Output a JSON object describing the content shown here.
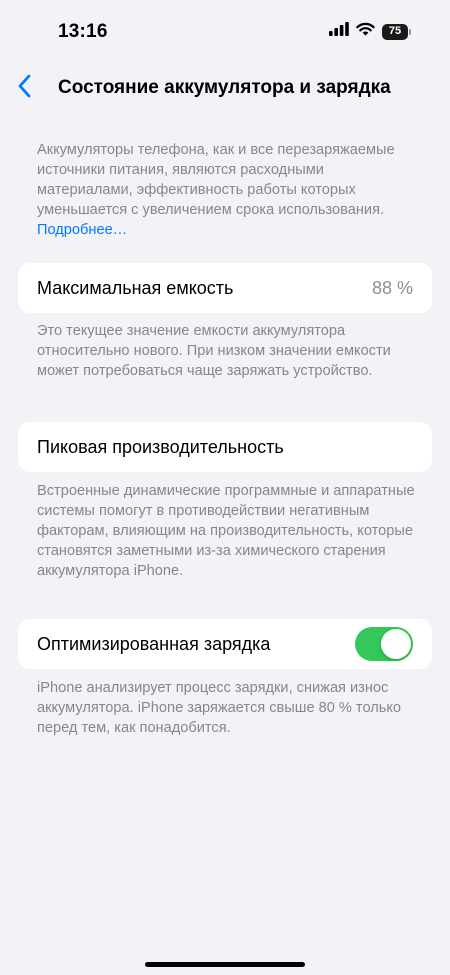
{
  "status_bar": {
    "time": "13:16",
    "battery_level": "75",
    "icons": [
      "signal-icon",
      "wifi-icon",
      "battery-icon"
    ]
  },
  "nav": {
    "back_icon": "chevron-left-icon",
    "title": "Состояние аккумулятора и зарядка"
  },
  "intro": {
    "text": "Аккумуляторы телефона, как и все перезаряжаемые источники питания, являются расходными материалами, эффективность работы которых уменьшается с увеличением срока использования. ",
    "link": "Подробнее…"
  },
  "max_capacity": {
    "label": "Максимальная емкость",
    "value": "88 %",
    "description": "Это текущее значение емкости аккумулятора относительно нового. При низком значении емкости может потребоваться чаще заряжать устройство."
  },
  "peak_performance": {
    "label": "Пиковая производительность",
    "description": "Встроенные динамические программные и аппаратные системы помогут в противодействии негативным факторам, влияющим на производительность, которые становятся заметными из-за химического старения аккумулятора iPhone."
  },
  "optimized_charging": {
    "label": "Оптимизированная зарядка",
    "enabled": true,
    "description": "iPhone анализирует процесс зарядки, снижая износ аккумулятора. iPhone заряжается свыше 80 % только перед тем, как понадобится."
  },
  "colors": {
    "accent": "#007aff",
    "toggle_on": "#34c759",
    "background": "#f2f2f7",
    "secondary_text": "#86868b"
  }
}
